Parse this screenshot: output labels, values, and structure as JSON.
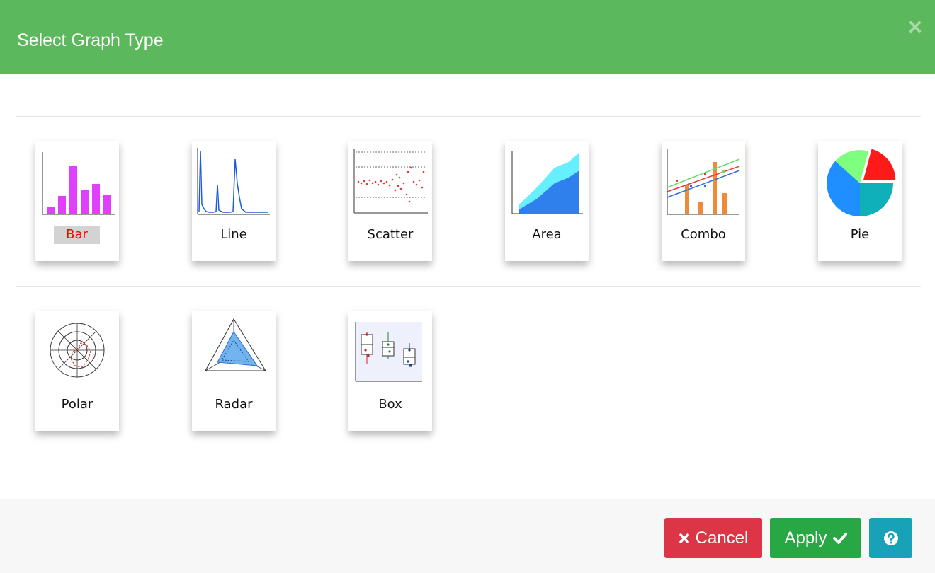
{
  "dialog": {
    "title": "Select Graph Type"
  },
  "graph_types": [
    {
      "label": "Bar",
      "selected": true
    },
    {
      "label": "Line",
      "selected": false
    },
    {
      "label": "Scatter",
      "selected": false
    },
    {
      "label": "Area",
      "selected": false
    },
    {
      "label": "Combo",
      "selected": false
    },
    {
      "label": "Pie",
      "selected": false
    },
    {
      "label": "Polar",
      "selected": false
    },
    {
      "label": "Radar",
      "selected": false
    },
    {
      "label": "Box",
      "selected": false
    }
  ],
  "footer": {
    "cancel_label": "Cancel",
    "apply_label": "Apply"
  },
  "icons": {
    "close": "close-icon",
    "cancel": "times-icon",
    "apply": "check-icon",
    "help": "question-circle-icon"
  },
  "colors": {
    "header": "#5cb85c",
    "cancel": "#dc3545",
    "apply": "#28a745",
    "help": "#17a2b8",
    "selected_text": "#ff0000",
    "selected_bg": "#d3d3d3"
  }
}
